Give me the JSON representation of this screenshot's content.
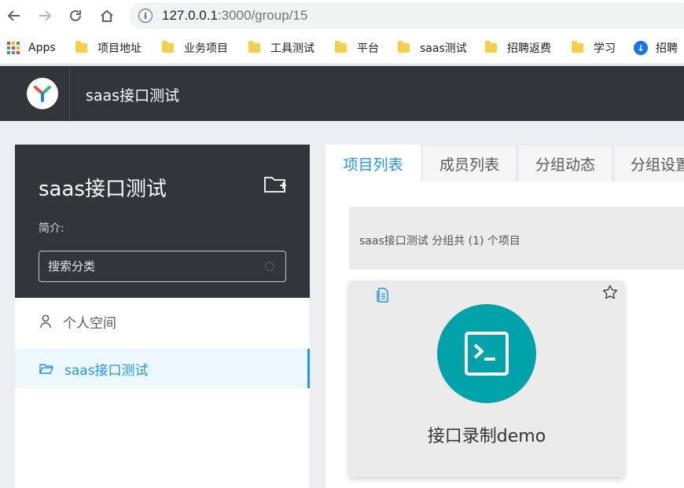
{
  "browser": {
    "url_host": "127.0.0.1",
    "url_path": ":3000/group/15",
    "bookmarks": [
      {
        "label": "Apps",
        "icon": "apps-grid-icon"
      },
      {
        "label": "项目地址",
        "icon": "folder-icon"
      },
      {
        "label": "业务项目",
        "icon": "folder-icon"
      },
      {
        "label": "工具测试",
        "icon": "folder-icon"
      },
      {
        "label": "平台",
        "icon": "folder-icon"
      },
      {
        "label": "saas测试",
        "icon": "folder-icon"
      },
      {
        "label": "招聘返费",
        "icon": "folder-icon"
      },
      {
        "label": "学习",
        "icon": "folder-icon"
      },
      {
        "label": "招聘",
        "icon": "site-icon"
      }
    ]
  },
  "header": {
    "title": "saas接口测试"
  },
  "sidebar": {
    "group_name": "saas接口测试",
    "description_label": "简介:",
    "search_placeholder": "搜索分类",
    "items": [
      {
        "label": "个人空间",
        "icon": "user-icon"
      },
      {
        "label": "saas接口测试",
        "icon": "folder-open-icon"
      }
    ]
  },
  "tabs": [
    {
      "label": "项目列表"
    },
    {
      "label": "成员列表"
    },
    {
      "label": "分组动态"
    },
    {
      "label": "分组设置"
    }
  ],
  "main": {
    "info_text": "saas接口测试 分组共 (1) 个项目",
    "projects": [
      {
        "name": "接口录制demo",
        "logo_color": "#00a2a9",
        "icon": "terminal-icon"
      }
    ]
  },
  "colors": {
    "accent": "#2395f1",
    "header_bg": "#32363a",
    "project_logo": "#00a2a9"
  }
}
